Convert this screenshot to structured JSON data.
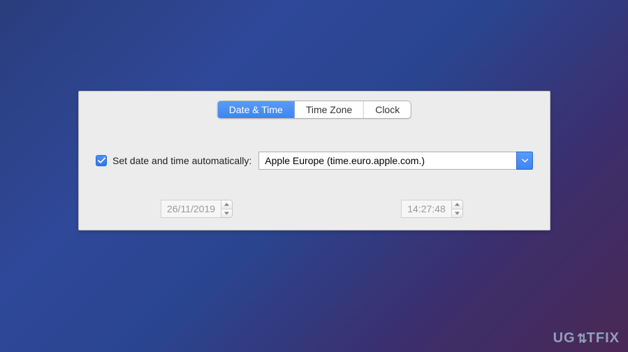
{
  "tabs": {
    "date_time": "Date & Time",
    "time_zone": "Time Zone",
    "clock": "Clock"
  },
  "auto": {
    "checked": true,
    "label": "Set date and time automatically:",
    "server": "Apple Europe (time.euro.apple.com.)"
  },
  "date_value": "26/11/2019",
  "time_value": "14:27:48",
  "watermark": "UGETFIX"
}
